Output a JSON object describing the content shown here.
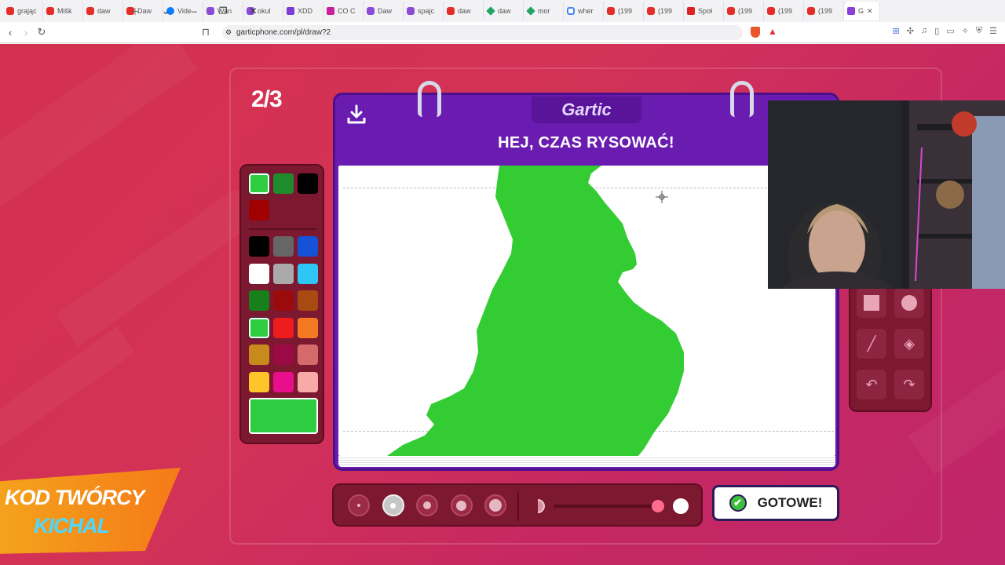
{
  "browser": {
    "tabs": [
      {
        "label": "grając",
        "icon": "youtube-icon"
      },
      {
        "label": "Mišk",
        "icon": "youtube-icon"
      },
      {
        "label": "daw",
        "icon": "youtube-icon"
      },
      {
        "label": "Daw",
        "icon": "youtube-icon"
      },
      {
        "label": "Vide",
        "icon": "meta-icon"
      },
      {
        "label": "Wan",
        "icon": "twitch-icon"
      },
      {
        "label": "okul",
        "icon": "twitch-icon"
      },
      {
        "label": "XDD",
        "icon": "xdd-icon"
      },
      {
        "label": "CO C",
        "icon": "co-icon"
      },
      {
        "label": "Daw",
        "icon": "twitch-icon"
      },
      {
        "label": "spajc",
        "icon": "twitch-icon"
      },
      {
        "label": "daw",
        "icon": "youtube-icon"
      },
      {
        "label": "daw",
        "icon": "drive-icon"
      },
      {
        "label": "mor",
        "icon": "drive-icon"
      },
      {
        "label": "wher",
        "icon": "google-icon"
      },
      {
        "label": "(199",
        "icon": "youtube-icon"
      },
      {
        "label": "(199",
        "icon": "youtube-icon"
      },
      {
        "label": "Społ",
        "icon": "spotify-icon"
      },
      {
        "label": "(199",
        "icon": "youtube-icon"
      },
      {
        "label": "(199",
        "icon": "youtube-icon"
      },
      {
        "label": "(199",
        "icon": "youtube-icon"
      },
      {
        "label": "G",
        "icon": "gartic-icon",
        "active": true
      }
    ],
    "url": "garticphone.com/pl/draw?2"
  },
  "game": {
    "round": "2/3",
    "logo": "Gartic",
    "title": "HEJ, CZAS RYSOWAĆ!",
    "done_label": "GOTOWE!",
    "selected_color": "#2ecc40",
    "palette_recent": [
      "#2ecc40",
      "#1e8c2a",
      "#000000",
      "#a00000"
    ],
    "palette": [
      "#000000",
      "#666666",
      "#1552d6",
      "#ffffff",
      "#aaaaaa",
      "#2ec7f5",
      "#17801d",
      "#9b0b0b",
      "#a94a12",
      "#2ecc40",
      "#ee1c1c",
      "#f47a22",
      "#c88a1c",
      "#9b0a45",
      "#d46a6a",
      "#fdc52a",
      "#e90f8c",
      "#f7aaa6"
    ],
    "brush_sizes": 5,
    "selected_size_index": 1,
    "opacity_value": 1
  },
  "banner": {
    "line1": "KOD TWÓRCY",
    "line2": "KICHAL"
  }
}
